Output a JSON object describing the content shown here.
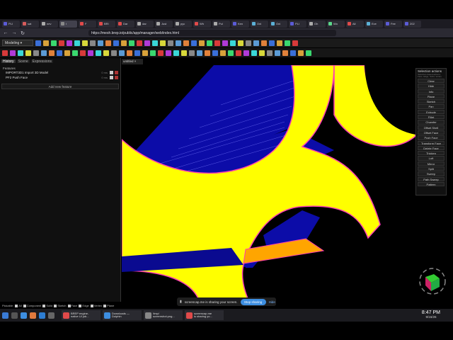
{
  "browser": {
    "tabs": [
      {
        "label": "PLI",
        "color": "#5b5bd6"
      },
      {
        "label": "sat",
        "color": "#d65b5b"
      },
      {
        "label": "nev",
        "color": "#aaaaaa"
      },
      {
        "label": "I",
        "color": "#888888"
      },
      {
        "label": "F",
        "color": "#e04a4a"
      },
      {
        "label": "BRI",
        "color": "#e04a4a"
      },
      {
        "label": "Dar",
        "color": "#e04a4a"
      },
      {
        "label": "dar",
        "color": "#aaaaaa"
      },
      {
        "label": "Just",
        "color": "#aaaaaa"
      },
      {
        "label": "pyc",
        "color": "#aaaaaa"
      },
      {
        "label": "Wh",
        "color": "#e04a4a"
      },
      {
        "label": "Pul",
        "color": "#aaaaaa"
      },
      {
        "label": "Ken",
        "color": "#5b5bd6"
      },
      {
        "label": "Onl",
        "color": "#5bb0d6"
      },
      {
        "label": "Onl",
        "color": "#5bb0d6"
      },
      {
        "label": "PLI",
        "color": "#5b5bd6"
      },
      {
        "label": "Oh",
        "color": "#aaaaaa"
      },
      {
        "label": "Wo",
        "color": "#5bd68a"
      },
      {
        "label": "All",
        "color": "#e04a4a"
      },
      {
        "label": "Eve",
        "color": "#5bb0d6"
      },
      {
        "label": "Fee",
        "color": "#5b5bd6"
      },
      {
        "label": "202",
        "color": "#5b5bd6"
      }
    ],
    "url": "https://mesh.brep.io/public/app/manager/web/index.html"
  },
  "app": {
    "mode": "Modeling",
    "sidebar_tabs": [
      "History",
      "Scene",
      "Expressions"
    ],
    "features_heading": "Features",
    "features": [
      {
        "label": "IMPORT3D1  Import 3D Model",
        "time": "0 ms"
      },
      {
        "label": "PF2  Push Face",
        "time": "0 ms"
      }
    ],
    "add_feature": "Add new feature",
    "doc_tab": "untitled",
    "selection_panel": {
      "title": "Selection actions",
      "subtitle": "Selection-based actions; Face, Edge, Solid, Vertex",
      "buttons": [
        "Clear",
        "Hide",
        "Info",
        "Plane",
        "Sketch",
        "Pan",
        "Extrude",
        "Fillet",
        "Chamfer",
        "Offset Shell",
        "Offset Face",
        "Push Face",
        "Transform Face",
        "Delete Face",
        "Thicken",
        "Loft",
        "Mirror",
        "Split",
        "Sweep",
        "Path Sweep",
        "Pattern"
      ]
    },
    "pickable_label": "Pickable:",
    "pickables": [
      "All",
      "Component",
      "Solid",
      "Sketch",
      "Face",
      "Edge",
      "Vertex",
      "Plane"
    ],
    "colors": {
      "face_yellow": "#ffff00",
      "face_blue": "#0c0ca8",
      "face_orange": "#ffa500",
      "edge_magenta": "#ff3cb4"
    }
  },
  "share": {
    "message": "screencap.me is sharing your screen.",
    "stop": "Stop sharing",
    "hide": "Hide"
  },
  "taskbar": {
    "windows": [
      {
        "line1": "BREP engine-",
        "line2": "native UI job..."
      },
      {
        "line1": "Downloads —",
        "line2": "Dolphin"
      },
      {
        "line1": "/tmp/",
        "line2": "screenshot.png..."
      },
      {
        "line1": "screencap.me",
        "line2": "is sharing yo..."
      }
    ],
    "time": "8:47 PM",
    "date": "9/16/26"
  }
}
